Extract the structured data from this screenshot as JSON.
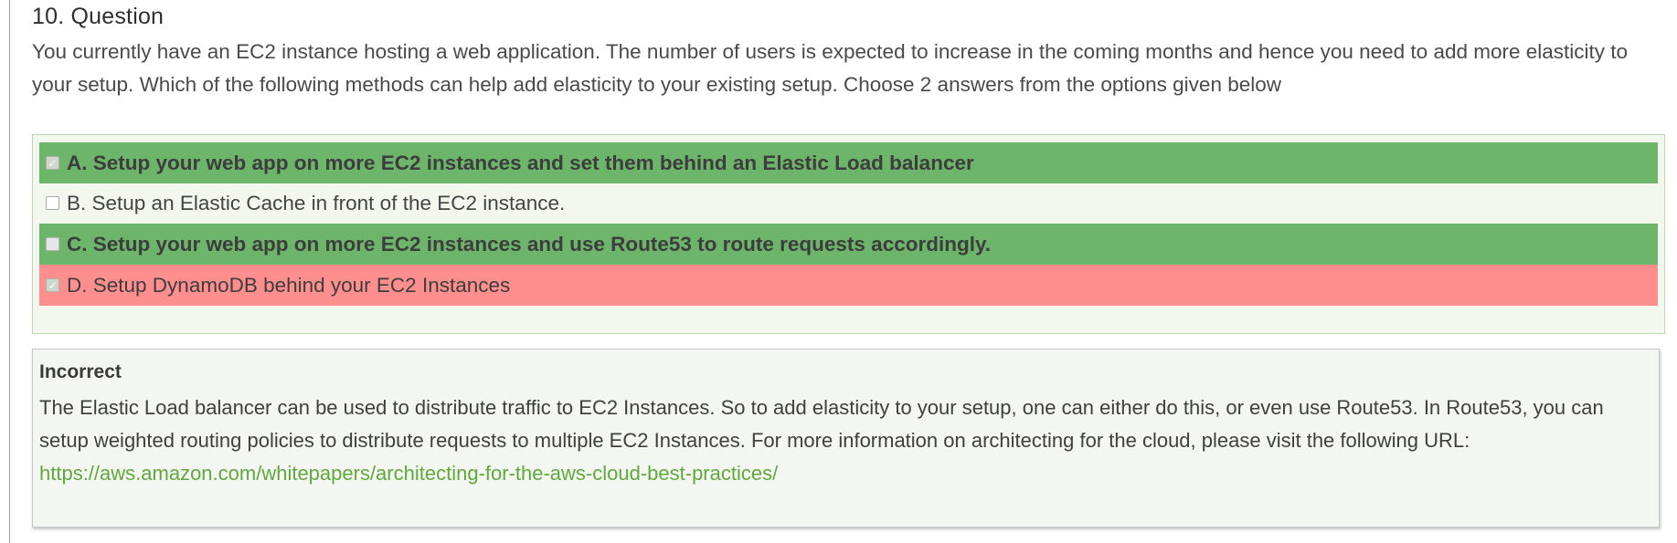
{
  "question": {
    "title": "10. Question",
    "text": "You currently have an EC2 instance hosting a web application. The number of users is expected to increase in the coming months and hence you need to add more elasticity to your setup. Which of the following methods can help add elasticity to your existing setup. Choose 2 answers from the options given below"
  },
  "options": [
    {
      "label": "A. Setup your web app on more EC2 instances and set them behind an Elastic Load balancer",
      "status": "correct",
      "checked": true
    },
    {
      "label": "B. Setup an Elastic Cache in front of the EC2 instance.",
      "status": "neutral",
      "checked": false
    },
    {
      "label": "C. Setup your web app on more EC2 instances and use Route53 to route requests accordingly.",
      "status": "correct",
      "checked": false
    },
    {
      "label": "D. Setup DynamoDB behind your EC2 Instances",
      "status": "incorrect",
      "checked": true
    }
  ],
  "explanation": {
    "result": "Incorrect",
    "text": "The Elastic Load balancer can be used to distribute traffic to EC2 Instances. So to add elasticity to your setup, one can either do this, or even use Route53. In Route53, you can setup weighted routing policies to distribute requests to multiple EC2 Instances. For more information on architecting for the cloud, please visit the following URL:",
    "link": "https://aws.amazon.com/whitepapers/architecting-for-the-aws-cloud-best-practices/"
  },
  "colors": {
    "correct": "#6db56a",
    "incorrect": "#fe8f8e",
    "link": "#5fa83c",
    "panel": "#f3f8ef"
  }
}
